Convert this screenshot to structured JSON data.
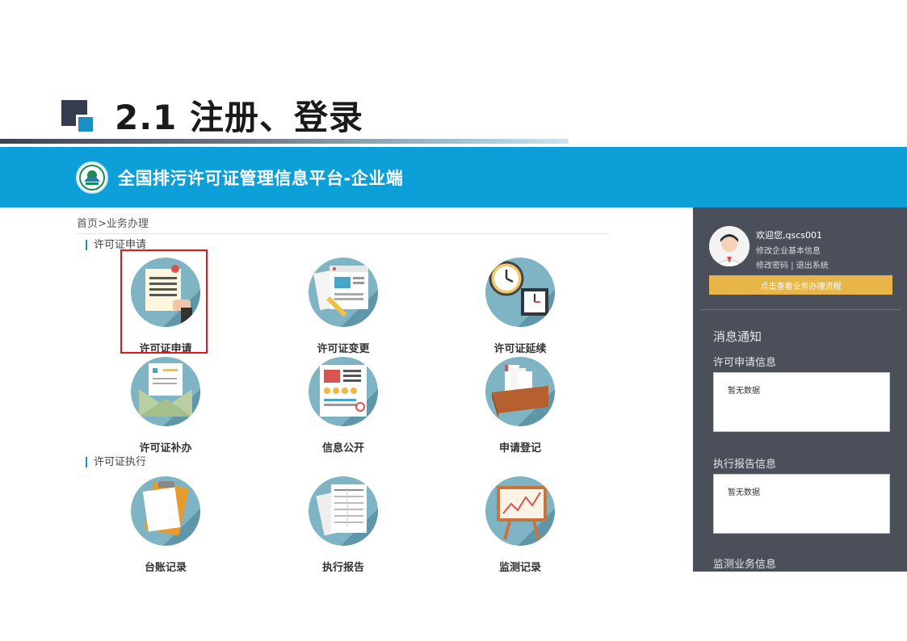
{
  "slide": {
    "title": "2.1  注册、登录",
    "colors": {
      "mark_dark": "#353c4e",
      "mark_accent": "#1a8fc6"
    }
  },
  "app": {
    "title": "全国排污许可证管理信息平台-企业端",
    "header_color": "#0d9fd8",
    "logo_icon": "mee-emblem-icon"
  },
  "breadcrumb": "首页>业务办理",
  "sections": {
    "apply": "许可证申请",
    "execute": "许可证执行"
  },
  "tiles": {
    "permit_apply": {
      "label": "许可证申请",
      "icon": "permit-document-icon"
    },
    "permit_change": {
      "label": "许可证变更",
      "icon": "form-edit-icon"
    },
    "permit_extend": {
      "label": "许可证延续",
      "icon": "clock-icon"
    },
    "permit_reissue": {
      "label": "许可证补办",
      "icon": "envelope-icon"
    },
    "info_public": {
      "label": "信息公开",
      "icon": "info-board-icon"
    },
    "registration": {
      "label": "申请登记",
      "icon": "file-box-icon"
    },
    "ledger": {
      "label": "台账记录",
      "icon": "clipboard-icon"
    },
    "report": {
      "label": "执行报告",
      "icon": "report-sheet-icon"
    },
    "monitoring": {
      "label": "监测记录",
      "icon": "chart-easel-icon"
    }
  },
  "sidebar": {
    "welcome": "欢迎您,qscs001",
    "modify_info": "修改企业基本信息",
    "modify_password": "修改密码",
    "separator": "|",
    "logout": "退出系统",
    "flow_button": "点击查看业务办理流程",
    "notice_title": "消息通知",
    "permit_info_title": "许可申请信息",
    "permit_info_empty": "暂无数据",
    "report_info_title": "执行报告信息",
    "report_info_empty": "暂无数据",
    "monitor_info_title": "监测业务信息",
    "colors": {
      "panel": "#4a4f59",
      "button": "#e8b648"
    }
  }
}
